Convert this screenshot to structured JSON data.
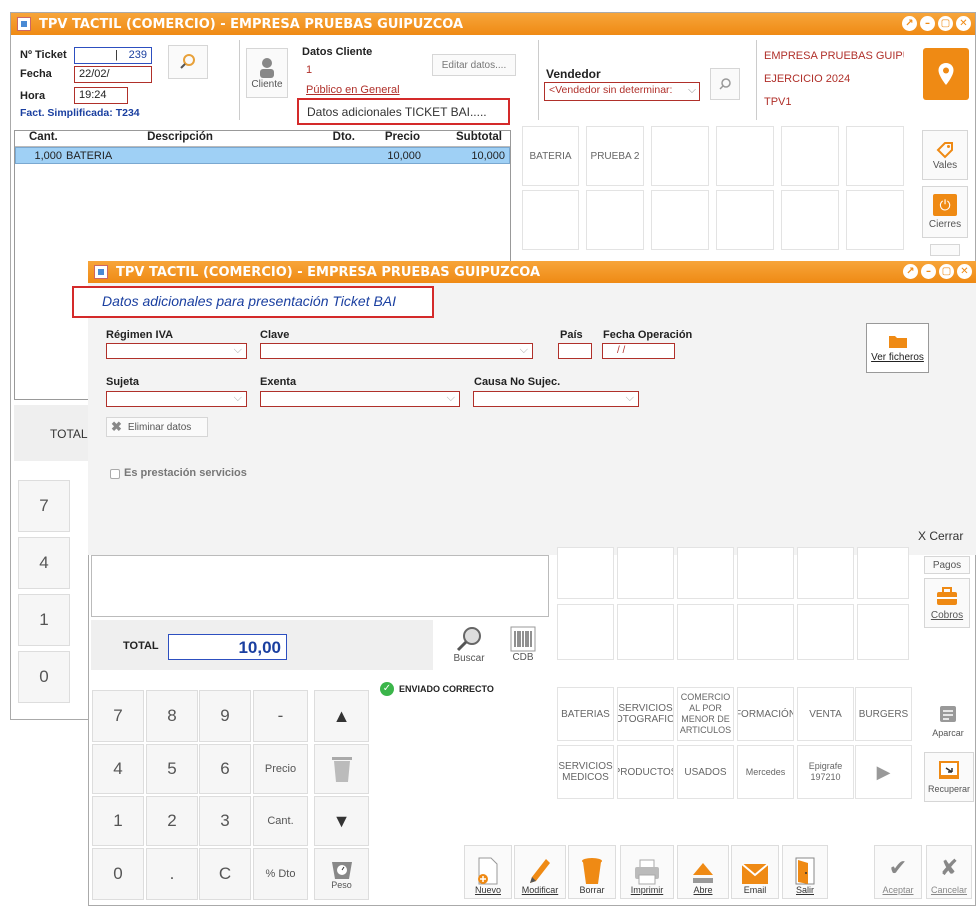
{
  "back": {
    "title": "TPV TACTIL (COMERCIO) - EMPRESA PRUEBAS GUIPUZCOA",
    "ticket_label": "Nº Ticket",
    "ticket_prefix": "|",
    "ticket_value": "239",
    "fecha_label": "Fecha",
    "fecha_value": "22/02/",
    "hora_label": "Hora",
    "hora_value": "19:24",
    "fact_simplificada": "Fact. Simplificada: T234",
    "cliente_button": "Cliente",
    "datos_cliente_label": "Datos Cliente",
    "cliente_num": "1",
    "cliente_nombre": "Público en General",
    "editar_datos": "Editar datos....",
    "datos_ticketbai": "Datos adicionales TICKET BAI.....",
    "vendedor_label": "Vendedor",
    "vendedor_value": "<Vendedor sin determinar:",
    "empresa": "EMPRESA PRUEBAS GUIPUZC(",
    "ejercicio": "EJERCICIO 2024",
    "tpv": "TPV1",
    "columns": [
      "Cant.",
      "Descripción",
      "Dto.",
      "Precio",
      "Subtotal"
    ],
    "row": {
      "cant": "1,000",
      "desc": "BATERIA",
      "dto": "",
      "precio": "10,000",
      "subtotal": "10,000"
    },
    "tiles": [
      "BATERIA",
      "PRUEBA 2"
    ],
    "vales": "Vales",
    "cierres": "Cierres",
    "total_label": "TOTAL",
    "keys": [
      "7",
      "4",
      "1",
      "0"
    ]
  },
  "dialog": {
    "title": "TPV TACTIL (COMERCIO) - EMPRESA PRUEBAS GUIPUZCOA",
    "heading": "Datos adicionales para presentación Ticket BAI",
    "regimen_iva_label": "Régimen IVA",
    "clave_label": "Clave",
    "pais_label": "País",
    "fecha_operacion_label": "Fecha Operación",
    "fecha_operacion_value": "/ /",
    "ver_ficheros": "Ver ficheros",
    "sujeta_label": "Sujeta",
    "exenta_label": "Exenta",
    "causa_label": "Causa No Sujec.",
    "eliminar_datos": "Eliminar datos",
    "es_prestacion": "Es prestación servicios",
    "cerrar": "X Cerrar"
  },
  "front": {
    "total_label": "TOTAL",
    "total_value": "10,00",
    "buscar": "Buscar",
    "cdb": "CDB",
    "enviado": "ENVIADO CORRECTO",
    "keypad": [
      "7",
      "8",
      "9",
      "-",
      "4",
      "5",
      "6",
      "Precio",
      "1",
      "2",
      "3",
      "Cant.",
      "0",
      ".",
      "C",
      "% Dto"
    ],
    "peso": "Peso",
    "pagos": "Pagos",
    "cobros": "Cobros",
    "aparcar": "Aparcar",
    "recuperar": "Recuperar",
    "categories_row1": [
      "BATERIAS",
      "SERVICIOS FOTOGRAFICO",
      "COMERCIO AL POR MENOR DE ARTICULOS",
      "FORMACIÓN",
      "VENTA",
      "BURGERS"
    ],
    "categories_row2": [
      "SERVICIOS MEDICOS",
      "PRODUCTOS",
      "USADOS",
      "Mercedes",
      "Epigrafe 197210"
    ],
    "toolbar": [
      "Nuevo",
      "Modificar",
      "Borrar",
      "Imprimir",
      "Abre",
      "Email",
      "Salir",
      "Aceptar",
      "Cancelar"
    ],
    "colors": {
      "accent": "#ef8a14",
      "highlight": "#d42a2a",
      "link": "#1a3fa0",
      "selected_row": "#9fd0f5"
    }
  }
}
